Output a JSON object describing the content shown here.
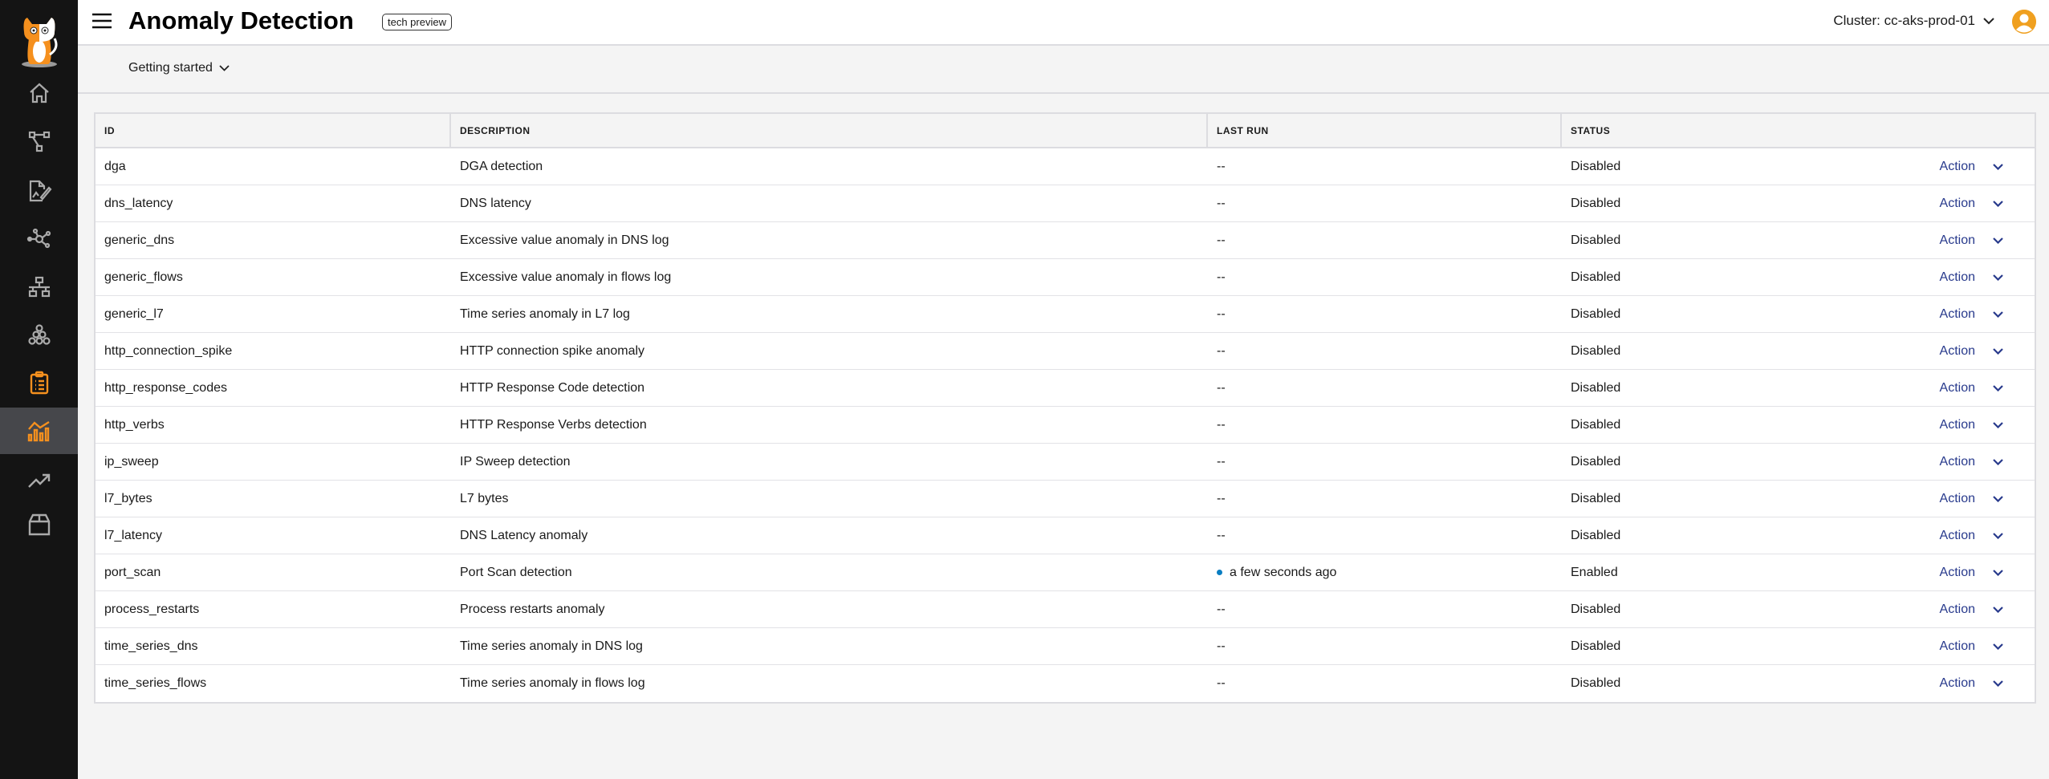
{
  "header": {
    "title": "Anomaly Detection",
    "badge": "tech preview",
    "cluster": "Cluster: cc-aks-prod-01"
  },
  "subbar": {
    "getting_started": "Getting started"
  },
  "sidebar": {
    "items": [
      "home-icon",
      "flow-icon",
      "report-icon",
      "graph-icon",
      "network-icon",
      "cluster-icon",
      "clipboard-icon",
      "anomaly-chart-icon",
      "trend-icon",
      "box-icon"
    ],
    "active": "anomaly-chart-icon",
    "accent": "#f5901e"
  },
  "table": {
    "columns": [
      "ID",
      "DESCRIPTION",
      "LAST RUN",
      "STATUS"
    ],
    "action_label": "Action",
    "rows": [
      {
        "id": "dga",
        "description": "DGA detection",
        "last_run": "--",
        "status": "Disabled"
      },
      {
        "id": "dns_latency",
        "description": "DNS latency",
        "last_run": "--",
        "status": "Disabled"
      },
      {
        "id": "generic_dns",
        "description": "Excessive value anomaly in DNS log",
        "last_run": "--",
        "status": "Disabled"
      },
      {
        "id": "generic_flows",
        "description": "Excessive value anomaly in flows log",
        "last_run": "--",
        "status": "Disabled"
      },
      {
        "id": "generic_l7",
        "description": "Time series anomaly in L7 log",
        "last_run": "--",
        "status": "Disabled"
      },
      {
        "id": "http_connection_spike",
        "description": "HTTP connection spike anomaly",
        "last_run": "--",
        "status": "Disabled"
      },
      {
        "id": "http_response_codes",
        "description": "HTTP Response Code detection",
        "last_run": "--",
        "status": "Disabled"
      },
      {
        "id": "http_verbs",
        "description": "HTTP Response Verbs detection",
        "last_run": "--",
        "status": "Disabled"
      },
      {
        "id": "ip_sweep",
        "description": "IP Sweep detection",
        "last_run": "--",
        "status": "Disabled"
      },
      {
        "id": "l7_bytes",
        "description": "L7 bytes",
        "last_run": "--",
        "status": "Disabled"
      },
      {
        "id": "l7_latency",
        "description": "DNS Latency anomaly",
        "last_run": "--",
        "status": "Disabled"
      },
      {
        "id": "port_scan",
        "description": "Port Scan detection",
        "last_run": "a few seconds ago",
        "status": "Enabled",
        "running": true
      },
      {
        "id": "process_restarts",
        "description": "Process restarts anomaly",
        "last_run": "--",
        "status": "Disabled"
      },
      {
        "id": "time_series_dns",
        "description": "Time series anomaly in DNS log",
        "last_run": "--",
        "status": "Disabled"
      },
      {
        "id": "time_series_flows",
        "description": "Time series anomaly in flows log",
        "last_run": "--",
        "status": "Disabled"
      }
    ]
  }
}
